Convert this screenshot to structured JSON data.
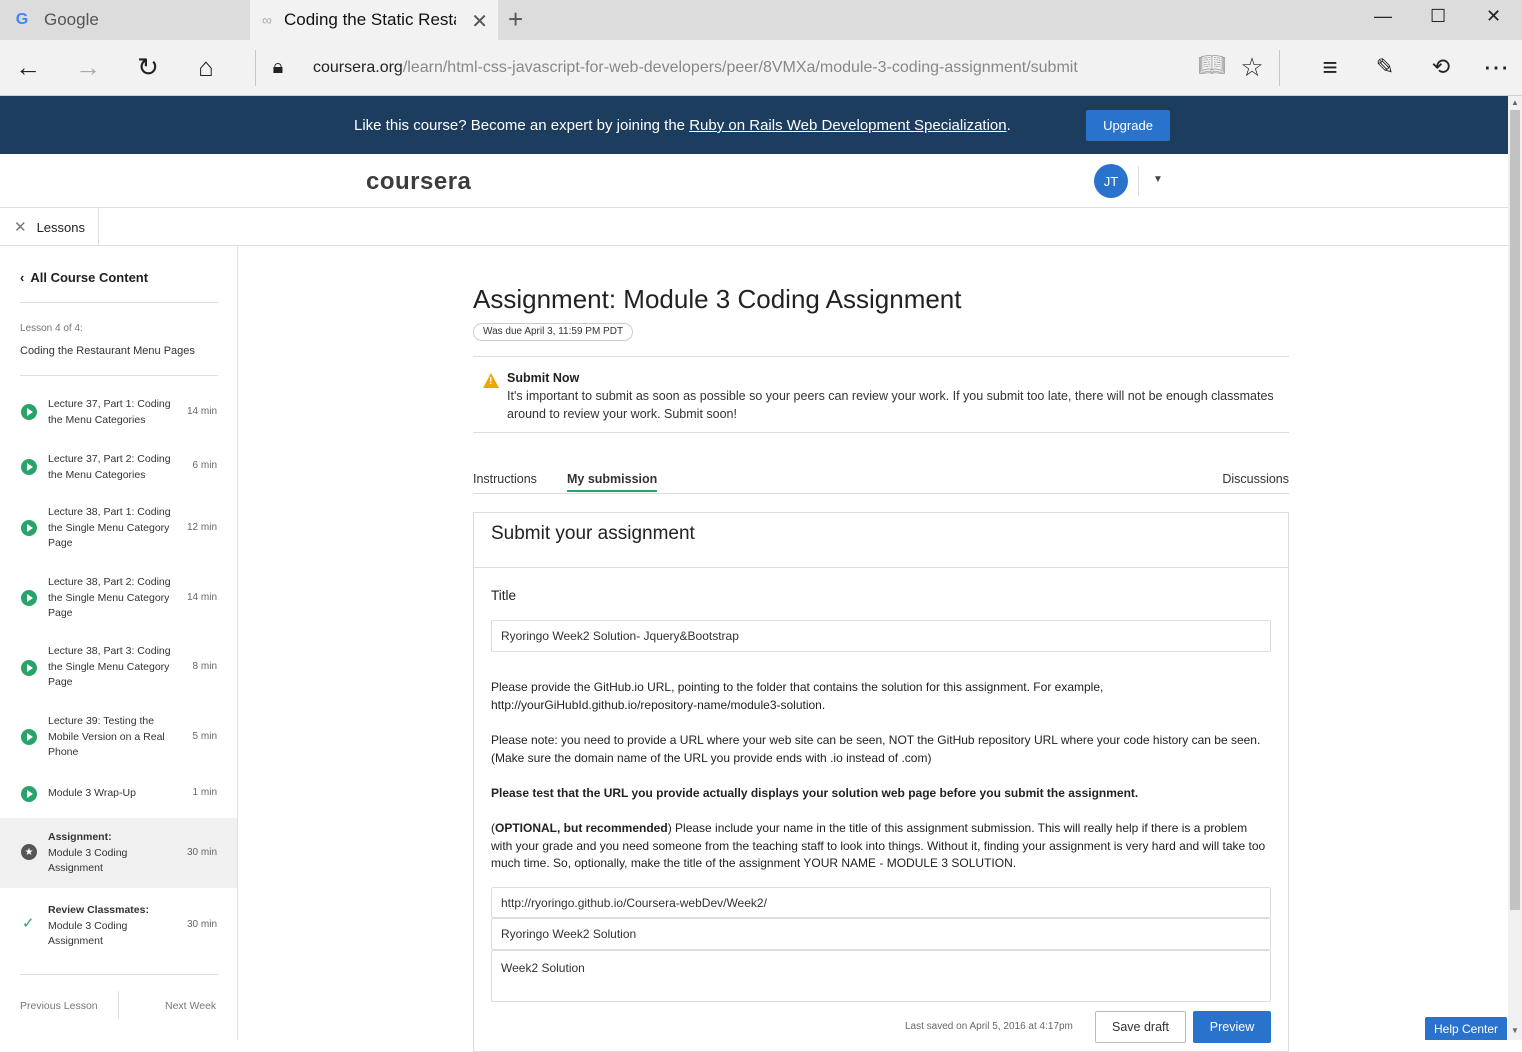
{
  "browser": {
    "tabs": [
      {
        "title": "Google",
        "icon": "google-icon"
      },
      {
        "title": "Coding the Static Restau",
        "icon": "coursera-icon"
      }
    ],
    "url_host": "coursera.org",
    "url_path": "/learn/html-css-javascript-for-web-developers/peer/8VMXa/module-3-coding-assignment/submit"
  },
  "promo": {
    "text_before": "Like this course? Become an expert by joining the ",
    "link": "Ruby on Rails Web Development Specialization",
    "text_after": ".",
    "button": "Upgrade"
  },
  "header": {
    "logo": "coursera",
    "avatar_initials": "JT"
  },
  "lessons_toggle": "Lessons",
  "sidebar": {
    "back_link": "All Course Content",
    "lesson_meta": "Lesson 4 of 4:",
    "lesson_name": "Coding the Restaurant Menu Pages",
    "items": [
      {
        "label": "Lecture 37, Part 1: Coding the Menu Categories",
        "duration": "14 min",
        "type": "video"
      },
      {
        "label": "Lecture 37, Part 2: Coding the Menu Categories",
        "duration": "6 min",
        "type": "video"
      },
      {
        "label": "Lecture 38, Part 1: Coding the Single Menu Category Page",
        "duration": "12 min",
        "type": "video"
      },
      {
        "label": "Lecture 38, Part 2: Coding the Single Menu Category Page",
        "duration": "14 min",
        "type": "video"
      },
      {
        "label": "Lecture 38, Part 3: Coding the Single Menu Category Page",
        "duration": "8 min",
        "type": "video"
      },
      {
        "label": "Lecture 39: Testing the Mobile Version on a Real Phone",
        "duration": "5 min",
        "type": "video"
      },
      {
        "label": "Module 3 Wrap-Up",
        "duration": "1 min",
        "type": "video"
      },
      {
        "label_bold": "Assignment:",
        "label": "Module 3 Coding Assignment",
        "duration": "30 min",
        "type": "assignment"
      },
      {
        "label_bold": "Review Classmates:",
        "label": "Module 3 Coding Assignment",
        "duration": "30 min",
        "type": "review"
      }
    ],
    "prev": "Previous Lesson",
    "next": "Next Week"
  },
  "main": {
    "title": "Assignment: Module 3 Coding Assignment",
    "due": "Was due April 3, 11:59 PM PDT",
    "warning": {
      "title": "Submit Now",
      "text": "It's important to submit as soon as possible so your peers can review your work. If you submit too late, there will not be enough classmates around to review your work. Submit soon!"
    },
    "tabs": [
      "Instructions",
      "My submission",
      "Discussions"
    ],
    "card_title": "Submit your assignment",
    "title_label": "Title",
    "title_value": "Ryoringo Week2 Solution- Jquery&Bootstrap",
    "para1": "Please provide the GitHub.io URL, pointing to the folder that contains the solution for this assignment. For example, http://yourGiHubId.github.io/repository-name/module3-solution.",
    "para2": "Please note: you need to provide a URL where your web site can be seen, NOT the GitHub repository URL where your code history can be seen. (Make sure the domain name of the URL you provide ends with .io instead of .com)",
    "para3_bold": "Please test that the URL you provide actually displays your solution web page before you submit the assignment.",
    "para4_open": "(",
    "para4_bold": "OPTIONAL, but recommended",
    "para4_rest": ") Please include your name in the title of this assignment submission. This will really help if there is a problem with your grade and you need someone from the teaching staff to look into things. Without it, finding your assignment is very hard and will take too much time. So, optionally, make the title of the assignment YOUR NAME - MODULE 3 SOLUTION.",
    "url_value": "http://ryoringo.github.io/Coursera-webDev/Week2/",
    "url_title_value": "Ryoringo Week2 Solution",
    "description_value": "Week2 Solution",
    "last_saved": "Last saved on April 5, 2016 at 4:17pm",
    "save_draft": "Save draft",
    "preview": "Preview"
  },
  "help_center": "Help Center"
}
